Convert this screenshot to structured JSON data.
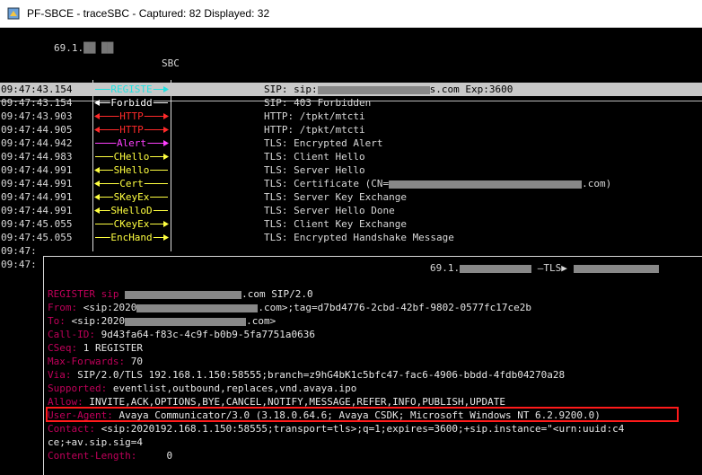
{
  "window": {
    "title": "PF-SBCE - traceSBC - Captured: 82  Displayed: 32"
  },
  "header": {
    "ip": "69.1.",
    "ip_masked": "██ ██",
    "node": "SBC"
  },
  "colors": {
    "red": "#ff2a2a",
    "magenta": "#ff40ff",
    "yellow": "#ffff40",
    "cyan": "#20e0e0",
    "white": "#ffffff",
    "header_name": "#c0005a"
  },
  "rows": [
    {
      "time": "09:47:43.154",
      "label": "REGISTE",
      "dir": "right",
      "color": "cyan",
      "info": "SIP: sip:",
      "info_after": "s.com Exp:3600",
      "masked": true,
      "selected": true
    },
    {
      "time": "09:47:43.154",
      "label": "Forbidd",
      "dir": "left",
      "color": "white",
      "info": "SIP: 403 Forbidden"
    },
    {
      "time": "09:47:43.903",
      "label": "HTTP",
      "dir": "both",
      "color": "red",
      "info": "HTTP: /tpkt/mtcti"
    },
    {
      "time": "09:47:44.905",
      "label": "HTTP",
      "dir": "both",
      "color": "red",
      "info": "HTTP: /tpkt/mtcti"
    },
    {
      "time": "09:47:44.942",
      "label": "Alert",
      "dir": "right",
      "color": "magenta",
      "info": "TLS: Encrypted Alert"
    },
    {
      "time": "09:47:44.983",
      "label": "CHello",
      "dir": "right",
      "color": "yellow",
      "info": "TLS: Client Hello"
    },
    {
      "time": "09:47:44.991",
      "label": "SHello",
      "dir": "left",
      "color": "yellow",
      "info": "TLS: Server Hello"
    },
    {
      "time": "09:47:44.991",
      "label": "Cert",
      "dir": "left",
      "color": "yellow",
      "info": "TLS: Certificate (CN=",
      "info_after": ".com)",
      "masked": true
    },
    {
      "time": "09:47:44.991",
      "label": "SKeyEx",
      "dir": "left",
      "color": "yellow",
      "info": "TLS: Server Key Exchange"
    },
    {
      "time": "09:47:44.991",
      "label": "SHelloD",
      "dir": "left",
      "color": "yellow",
      "info": "TLS: Server Hello Done"
    },
    {
      "time": "09:47:45.055",
      "label": "CKeyEx",
      "dir": "right",
      "color": "yellow",
      "info": "TLS: Client Key Exchange"
    },
    {
      "time": "09:47:45.055",
      "label": "EncHand",
      "dir": "right",
      "color": "yellow",
      "info": "TLS: Encrypted Handshake Message"
    },
    {
      "time": "09:47:",
      "label": "",
      "dir": "none",
      "color": "white",
      "info": ""
    },
    {
      "time": "09:47:",
      "label": "",
      "dir": "none",
      "color": "white",
      "info": ""
    }
  ],
  "popup": {
    "header_ip": "69.1.",
    "header_proto": "TLS",
    "lines": [
      {
        "name": "REGISTER sip",
        "value": ".com SIP/2.0",
        "masked": true
      },
      {
        "name": "From:",
        "value": " <sip:2020",
        "value_after": ".com>;tag=d7bd4776-2cbd-42bf-9802-0577fc17ce2b",
        "masked": true
      },
      {
        "name": "To:",
        "value": " <sip:2020",
        "value_after": ".com>",
        "masked": true
      },
      {
        "name": "Call-ID:",
        "value": " 9d43fa64-f83c-4c9f-b0b9-5fa7751a0636"
      },
      {
        "name": "CSeq:",
        "value": " 1 REGISTER"
      },
      {
        "name": "Max-Forwards:",
        "value": " 70"
      },
      {
        "name": "Via:",
        "value": " SIP/2.0/TLS 192.168.1.150:58555;branch=z9hG4bK1c5bfc47-fac6-4906-bbdd-4fdb04270a28"
      },
      {
        "name": "Supported:",
        "value": " eventlist,outbound,replaces,vnd.avaya.ipo"
      },
      {
        "name": "Allow:",
        "value": " INVITE,ACK,OPTIONS,BYE,CANCEL,NOTIFY,MESSAGE,REFER,INFO,PUBLISH,UPDATE"
      },
      {
        "name": "User-Agent:",
        "value": " Avaya Communicator/3.0 (3.18.0.64.6; Avaya CSDK; Microsoft Windows NT 6.2.9200.0)",
        "highlight": true
      },
      {
        "name": "Contact:",
        "value": " <sip:2020192.168.1.150:58555;transport=tls>;q=1;expires=3600;+sip.instance=\"<urn:uuid:c4"
      },
      {
        "name": "",
        "value": "ce;+av.sip.sig=4"
      },
      {
        "name": "Content-Length:",
        "value": "     0"
      }
    ]
  }
}
